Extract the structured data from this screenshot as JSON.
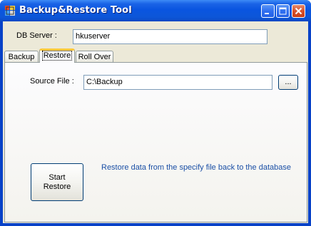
{
  "window": {
    "title": "Backup&Restore Tool"
  },
  "db_server": {
    "label": "DB Server :",
    "value": "hkuserver"
  },
  "tabs": [
    {
      "label": "Backup",
      "active": false
    },
    {
      "label": "Restore",
      "active": true
    },
    {
      "label": "Roll Over",
      "active": false
    }
  ],
  "restore_tab": {
    "source_file_label": "Source File :",
    "source_file_value": "C:\\Backup",
    "browse_label": "...",
    "start_line1": "Start",
    "start_line2": "Restore",
    "info_text": "Restore data from the specify file back to the database"
  },
  "colors": {
    "titlebar": "#0a55e0",
    "info_text": "#1b4fa6",
    "active_tab_highlight": "#ffc83c",
    "face": "#ece9d8"
  },
  "icons": {
    "app": "app-icon",
    "minimize": "minimize-icon",
    "maximize": "maximize-icon",
    "close": "close-icon"
  }
}
